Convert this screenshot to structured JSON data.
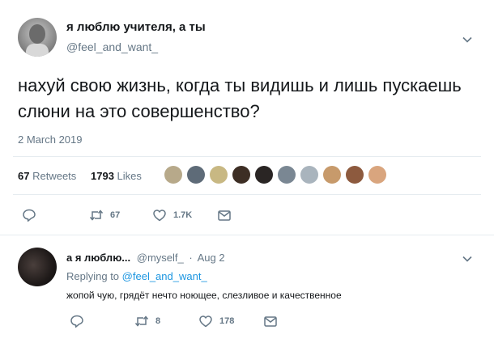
{
  "tweet": {
    "display_name": "я люблю учителя, а ты",
    "handle": "@feel_and_want_",
    "text": "нахуй свою жизнь, когда ты видишь и лишь пускаешь слюни на это совершенство?",
    "date": "2 March 2019",
    "retweets_count": "67",
    "retweets_label": "Retweets",
    "likes_count": "1793",
    "likes_label": "Likes",
    "actions": {
      "retweets": "67",
      "likes": "1.7K"
    }
  },
  "reply": {
    "display_name": "а я люблю...",
    "handle": "@myself_",
    "separator": "·",
    "date": "Aug 2",
    "replying_to_prefix": "Replying to",
    "replying_to_handle": "@feel_and_want_",
    "text": "жопой чую, грядёт нечто ноющее, слезливое и качественное",
    "actions": {
      "retweets": "8",
      "likes": "178"
    }
  },
  "colors": {
    "link": "#1b95e0",
    "muted": "#657786",
    "divider": "#e6ecf0"
  },
  "icons": [
    "chevron-down-icon",
    "reply-icon",
    "retweet-icon",
    "like-icon",
    "message-icon"
  ]
}
